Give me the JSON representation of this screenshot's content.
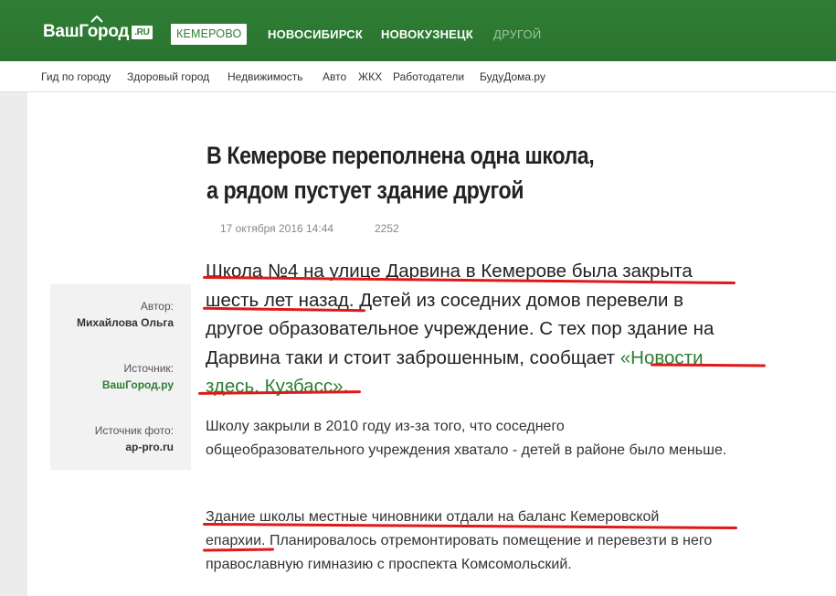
{
  "header": {
    "logo_text": "ВашГород",
    "logo_badge": ".RU",
    "cities": [
      {
        "label": "КЕМЕРОВО",
        "active": true
      },
      {
        "label": "НОВОСИБИРСК",
        "active": false
      },
      {
        "label": "НОВОКУЗНЕЦК",
        "active": false
      },
      {
        "label": "ДРУГОЙ",
        "active": false
      }
    ]
  },
  "subnav": {
    "items": [
      "Гид по городу",
      "Здоровый город",
      "Недвижимость",
      "Авто",
      "ЖКХ",
      "Работодатели",
      "БудуДома.ру"
    ]
  },
  "article": {
    "title_lines": [
      "В Кемерове переполнена одна школа,",
      "а рядом пустует здание другой"
    ],
    "date": "17 октября 2016 14:44",
    "views": "2252",
    "lead_lines": [
      "Школа №4 на улице Дарвина в Кемерове была закрыта",
      "шесть лет назад. Детей из соседних домов перевели в",
      " другое образовательное учреждение. С тех пор здание на",
      "Дарвина таки и стоит заброшенным, сообщает "
    ],
    "lead_link_part1": " «Новости",
    "lead_link_part2": "здесь. Кузбасс»",
    "lead_end": ".",
    "para1_lines": [
      "Школу закрыли в 2010 году из-за того, что соседнего",
      "общеобразовательного учреждения хватало - детей в районе было меньше."
    ],
    "para2_lines": [
      "Здание школы местные  чиновники отдали на баланс Кемеровской",
      "епархии.  Планировалось отремонтировать помещение и  перевезти в него",
      "православную гимназию с проспекта Комсомольский."
    ]
  },
  "sidebar": {
    "author_label": "Автор:",
    "author_value": "Михайлова Ольга",
    "source_label": "Источник:",
    "source_value": "ВашГород.ру",
    "photo_label": "Источник фото:",
    "photo_value": "ap-pro.ru"
  },
  "colors": {
    "header_green": "#2e7d32",
    "link_green": "#2e7d32",
    "annotation_red": "#e01818"
  }
}
